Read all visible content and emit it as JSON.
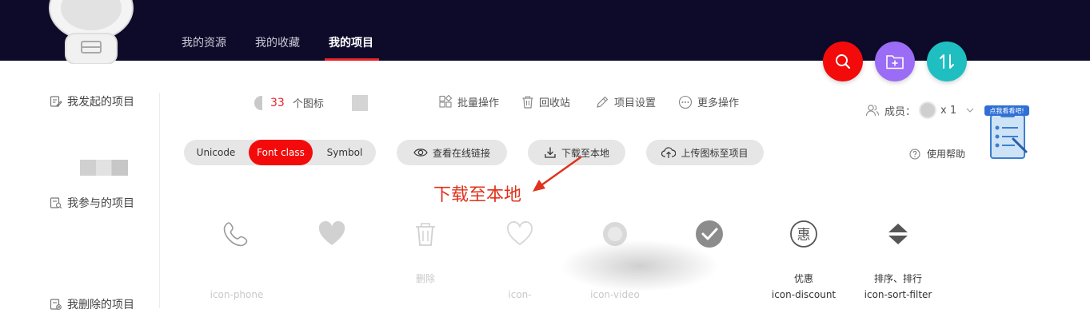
{
  "header": {
    "tabs": [
      {
        "label": "我的资源"
      },
      {
        "label": "我的收藏"
      },
      {
        "label": "我的项目"
      }
    ],
    "active_tab": "我的项目",
    "accent": "#e8232a",
    "background": "#0e0b2a"
  },
  "fabs": [
    {
      "icon": "search-icon",
      "color": "#f30b0b"
    },
    {
      "icon": "folder-plus-icon",
      "color": "#9b6cf5"
    },
    {
      "icon": "sort-icon",
      "color": "#1fbfc1"
    }
  ],
  "sidebar": {
    "items": [
      {
        "label": "我发起的项目",
        "icon": "edit-doc-icon"
      },
      {
        "label": "我参与的项目",
        "icon": "search-doc-icon"
      },
      {
        "label": "我删除的项目",
        "icon": "delete-doc-icon"
      }
    ]
  },
  "project": {
    "icon_count": "33",
    "icon_count_label": "个图标",
    "actions": [
      {
        "label": "批量操作",
        "icon": "batch-icon"
      },
      {
        "label": "回收站",
        "icon": "trash-icon"
      },
      {
        "label": "项目设置",
        "icon": "pencil-icon"
      },
      {
        "label": "更多操作",
        "icon": "more-icon"
      }
    ],
    "members_label": "成员：",
    "members_count": "x 1"
  },
  "code_tabs": {
    "items": [
      "Unicode",
      "Font class",
      "Symbol"
    ],
    "active": "Font class"
  },
  "buttons": {
    "online_link": "查看在线链接",
    "download": "下载至本地",
    "upload": "上传图标至项目"
  },
  "help_label": "使用帮助",
  "promo_label": "点我看看吧!",
  "annotation": "下载至本地",
  "icons": [
    {
      "name": "",
      "code": "icon-phone",
      "icon": "phone-icon",
      "faded": true
    },
    {
      "name": "",
      "code": "",
      "icon": "heart-filled-icon",
      "faded": true
    },
    {
      "name": "删除",
      "code": "",
      "icon": "trash-icon",
      "faded": true
    },
    {
      "name": "",
      "code": "icon-",
      "icon": "heart-outline-icon",
      "faded": true
    },
    {
      "name": "",
      "code": "icon-video",
      "icon": "video-icon",
      "faded": true
    },
    {
      "name": "",
      "code": "",
      "icon": "check-circle-icon",
      "faded": true
    },
    {
      "name": "优惠",
      "code": "icon-discount",
      "icon": "discount-icon",
      "faded": false
    },
    {
      "name": "排序、排行",
      "code": "icon-sort-filter",
      "icon": "sort-filter-icon",
      "faded": false
    }
  ]
}
